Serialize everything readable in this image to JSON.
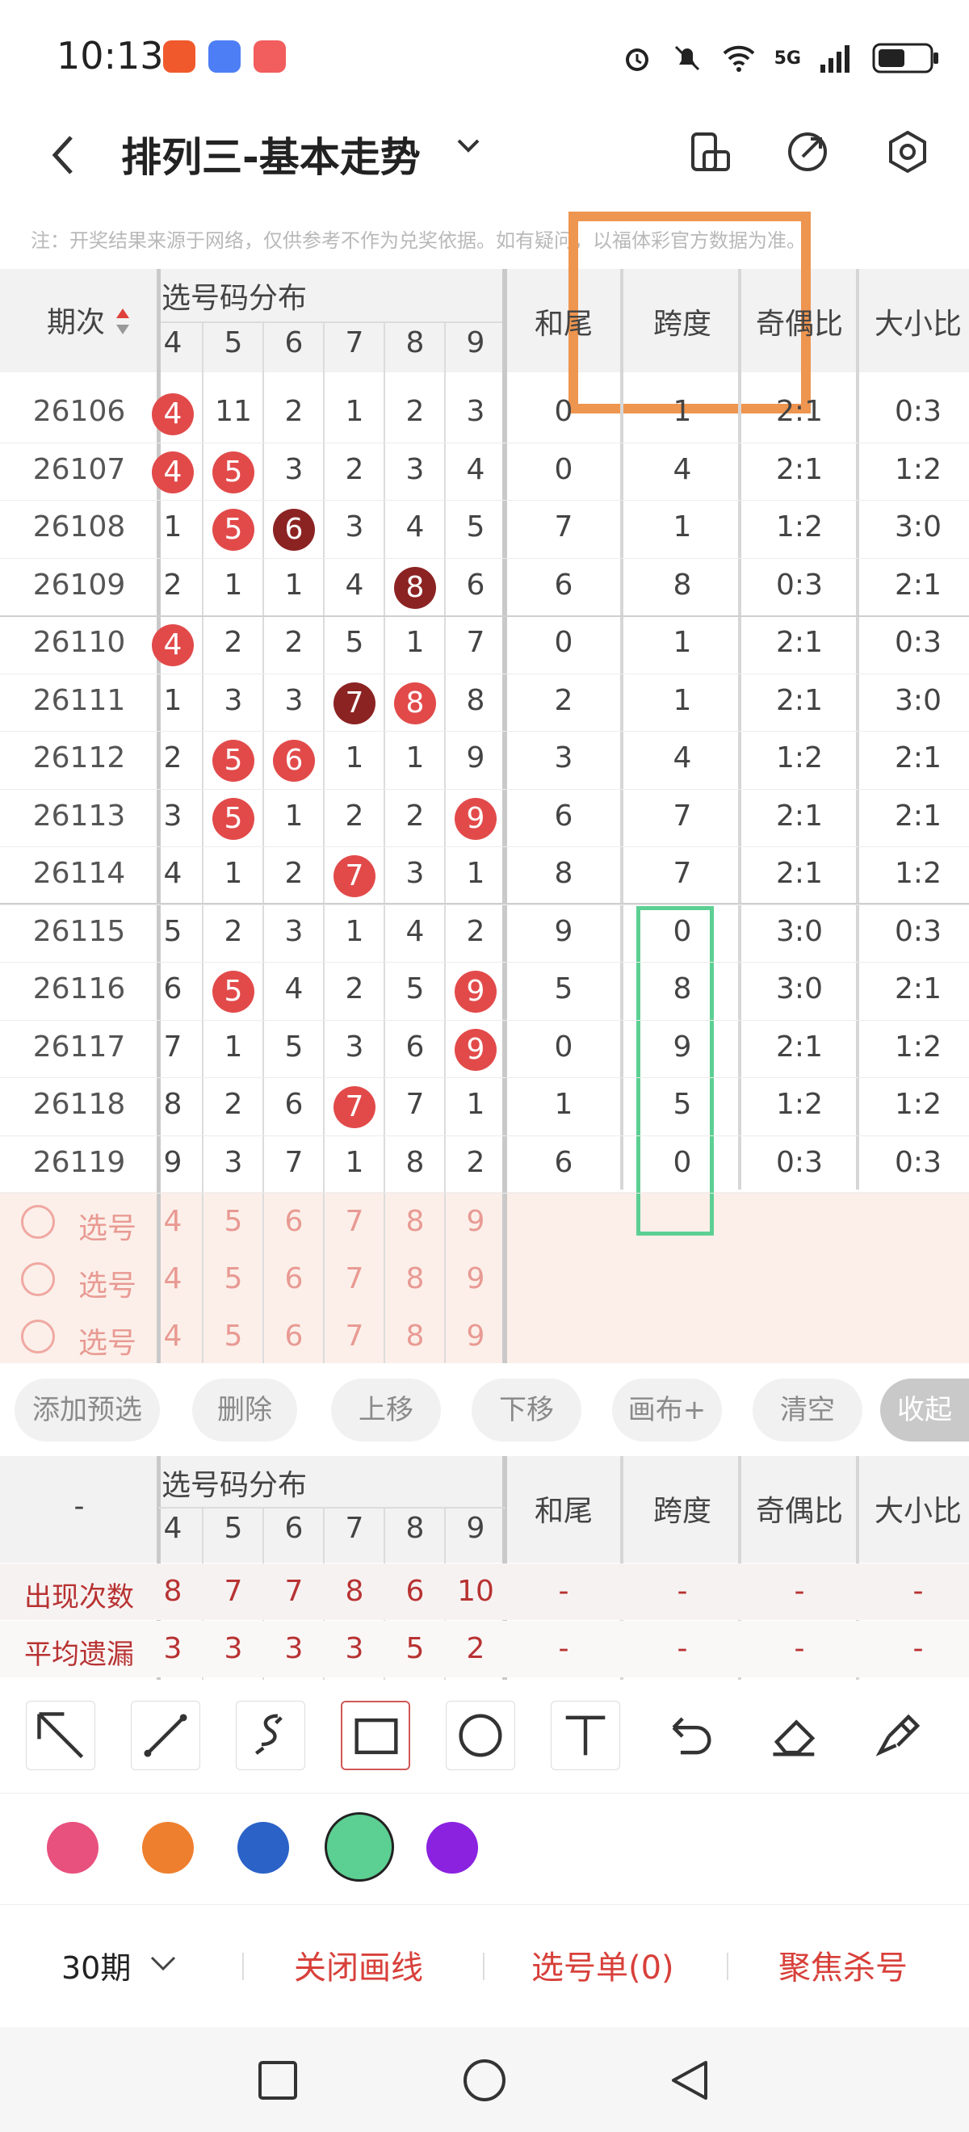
{
  "status_bar": {
    "time": "10:13",
    "network": "5G"
  },
  "header": {
    "title": "排列三-基本走势"
  },
  "notice": "注：开奖结果来源于网络，仅供参考不作为兑奖依据。如有疑问，以福体彩官方数据为准。",
  "table": {
    "col_period": "期次",
    "group_label": "选号码分布",
    "digit_headers": [
      "4",
      "5",
      "6",
      "7",
      "8",
      "9"
    ],
    "extra_headers": [
      "和尾",
      "跨度",
      "奇偶比",
      "大小比"
    ],
    "rows": [
      {
        "period": "26106",
        "digits": [
          "4",
          "11",
          "2",
          "1",
          "2",
          "3"
        ],
        "hewei": "0",
        "kuadu": "1",
        "jiou": "2:1",
        "daxiao": "0:3"
      },
      {
        "period": "26107",
        "digits": [
          "4",
          "5",
          "3",
          "2",
          "3",
          "4"
        ],
        "hewei": "0",
        "kuadu": "4",
        "jiou": "2:1",
        "daxiao": "1:2"
      },
      {
        "period": "26108",
        "digits": [
          "1",
          "5",
          "6",
          "3",
          "4",
          "5"
        ],
        "hewei": "7",
        "kuadu": "1",
        "jiou": "1:2",
        "daxiao": "3:0"
      },
      {
        "period": "26109",
        "digits": [
          "2",
          "1",
          "1",
          "4",
          "8",
          "6"
        ],
        "hewei": "6",
        "kuadu": "8",
        "jiou": "0:3",
        "daxiao": "2:1"
      },
      {
        "period": "26110",
        "digits": [
          "4",
          "2",
          "2",
          "5",
          "1",
          "7"
        ],
        "hewei": "0",
        "kuadu": "1",
        "jiou": "2:1",
        "daxiao": "0:3"
      },
      {
        "period": "26111",
        "digits": [
          "1",
          "3",
          "3",
          "7",
          "8",
          "8"
        ],
        "hewei": "2",
        "kuadu": "1",
        "jiou": "2:1",
        "daxiao": "3:0"
      },
      {
        "period": "26112",
        "digits": [
          "2",
          "5",
          "6",
          "1",
          "1",
          "9"
        ],
        "hewei": "3",
        "kuadu": "4",
        "jiou": "1:2",
        "daxiao": "2:1"
      },
      {
        "period": "26113",
        "digits": [
          "3",
          "5",
          "1",
          "2",
          "2",
          "9"
        ],
        "hewei": "6",
        "kuadu": "7",
        "jiou": "2:1",
        "daxiao": "2:1"
      },
      {
        "period": "26114",
        "digits": [
          "4",
          "1",
          "2",
          "7",
          "3",
          "1"
        ],
        "hewei": "8",
        "kuadu": "7",
        "jiou": "2:1",
        "daxiao": "1:2"
      },
      {
        "period": "26115",
        "digits": [
          "5",
          "2",
          "3",
          "1",
          "4",
          "2"
        ],
        "hewei": "9",
        "kuadu": "0",
        "jiou": "3:0",
        "daxiao": "0:3"
      },
      {
        "period": "26116",
        "digits": [
          "6",
          "5",
          "4",
          "2",
          "5",
          "9"
        ],
        "hewei": "5",
        "kuadu": "8",
        "jiou": "3:0",
        "daxiao": "2:1"
      },
      {
        "period": "26117",
        "digits": [
          "7",
          "1",
          "5",
          "3",
          "6",
          "9"
        ],
        "hewei": "0",
        "kuadu": "9",
        "jiou": "2:1",
        "daxiao": "1:2"
      },
      {
        "period": "26118",
        "digits": [
          "8",
          "2",
          "6",
          "7",
          "7",
          "1"
        ],
        "hewei": "1",
        "kuadu": "5",
        "jiou": "1:2",
        "daxiao": "1:2"
      },
      {
        "period": "26119",
        "digits": [
          "9",
          "3",
          "7",
          "1",
          "8",
          "2"
        ],
        "hewei": "6",
        "kuadu": "0",
        "jiou": "0:3",
        "daxiao": "0:3"
      }
    ],
    "selection_rows": [
      {
        "label": "选号",
        "digits": [
          "4",
          "5",
          "6",
          "7",
          "8",
          "9"
        ]
      },
      {
        "label": "选号",
        "digits": [
          "4",
          "5",
          "6",
          "7",
          "8",
          "9"
        ]
      },
      {
        "label": "选号",
        "digits": [
          "4",
          "5",
          "6",
          "7",
          "8",
          "9"
        ]
      }
    ]
  },
  "actions": [
    "添加预选",
    "删除",
    "上移",
    "下移",
    "画布+",
    "清空",
    "收起"
  ],
  "stats": {
    "col_period": "-",
    "group_label": "选号码分布",
    "digit_headers": [
      "4",
      "5",
      "6",
      "7",
      "8",
      "9"
    ],
    "extra_headers": [
      "和尾",
      "跨度",
      "奇偶比",
      "大小比"
    ],
    "rows": [
      {
        "label": "出现次数",
        "values": [
          "8",
          "7",
          "7",
          "8",
          "6",
          "10"
        ],
        "extras": [
          "-",
          "-",
          "-",
          "-"
        ]
      },
      {
        "label": "平均遗漏",
        "values": [
          "3",
          "3",
          "3",
          "3",
          "5",
          "2"
        ],
        "extras": [
          "-",
          "-",
          "-",
          "-"
        ]
      }
    ]
  },
  "tools": [
    "arrow-icon",
    "line-icon",
    "curve-icon",
    "rectangle-icon",
    "circle-icon",
    "text-icon",
    "undo-icon",
    "eraser-icon",
    "clear-brush-icon"
  ],
  "colors": [
    "#e8507e",
    "#ee7f2e",
    "#2a62c8",
    "#5ccf92",
    "#8a22e0"
  ],
  "bottom_bar": {
    "period_select": "30期",
    "close_drawing": "关闭画线",
    "selection_list": "选号单(0)",
    "focus_kill": "聚焦杀号"
  },
  "annotations": {
    "orange_rect_color": "#ee9550",
    "green_rect_color": "#5ccf92"
  }
}
